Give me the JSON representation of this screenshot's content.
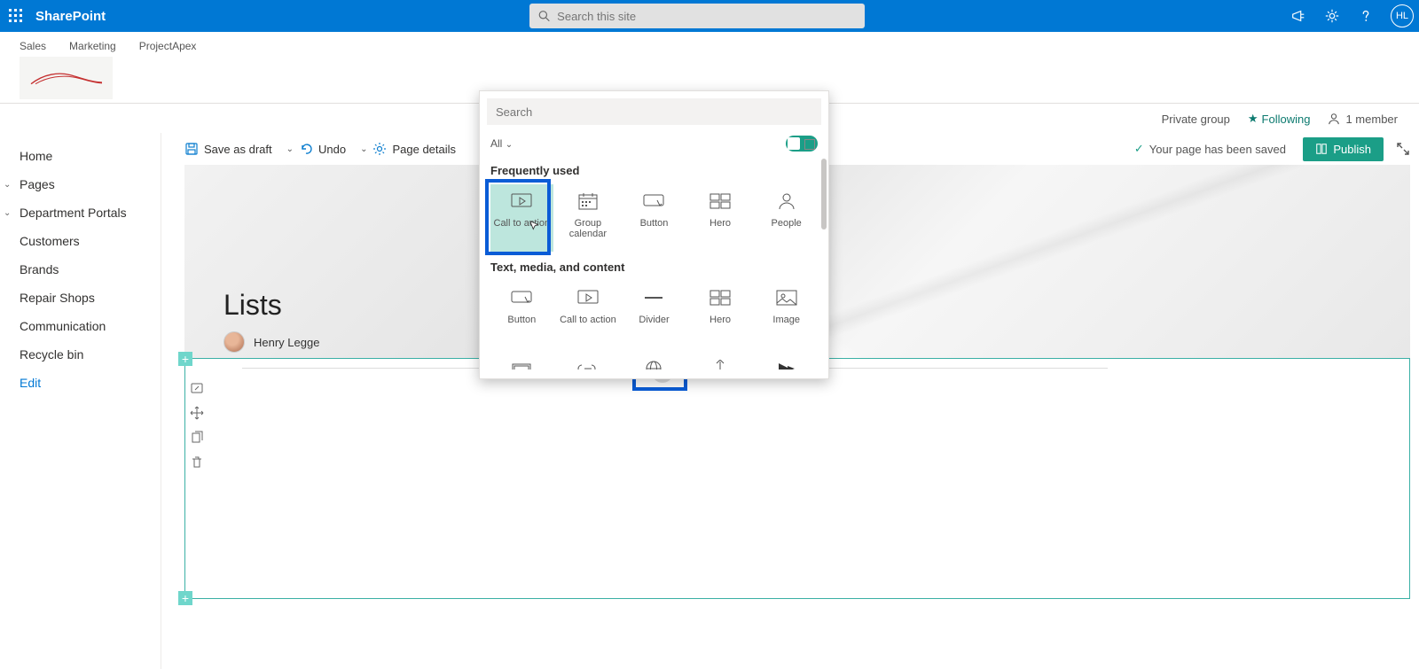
{
  "suite": {
    "product": "SharePoint",
    "search_placeholder": "Search this site",
    "avatar_initials": "HL"
  },
  "hub_nav": [
    "Sales",
    "Marketing",
    "ProjectApex"
  ],
  "info_bar": {
    "privacy": "Private group",
    "following": "Following",
    "members": "1 member"
  },
  "command_bar": {
    "save_draft": "Save as draft",
    "undo": "Undo",
    "page_details": "Page details",
    "saved_msg": "Your page has been saved",
    "publish": "Publish"
  },
  "left_nav": {
    "home": "Home",
    "pages": "Pages",
    "dept": "Department Portals",
    "customers": "Customers",
    "brands": "Brands",
    "repair": "Repair Shops",
    "comm": "Communication",
    "recycle": "Recycle bin",
    "edit": "Edit"
  },
  "page": {
    "title": "Lists",
    "author": "Henry Legge"
  },
  "picker": {
    "search_placeholder": "Search",
    "filter_all": "All",
    "cat_freq": "Frequently used",
    "cat_text": "Text, media, and content",
    "freq": [
      {
        "label": "Call to action"
      },
      {
        "label": "Group calendar"
      },
      {
        "label": "Button"
      },
      {
        "label": "Hero"
      },
      {
        "label": "People"
      }
    ],
    "text_media": [
      {
        "label": "Button"
      },
      {
        "label": "Call to action"
      },
      {
        "label": "Divider"
      },
      {
        "label": "Hero"
      },
      {
        "label": "Image"
      }
    ]
  }
}
